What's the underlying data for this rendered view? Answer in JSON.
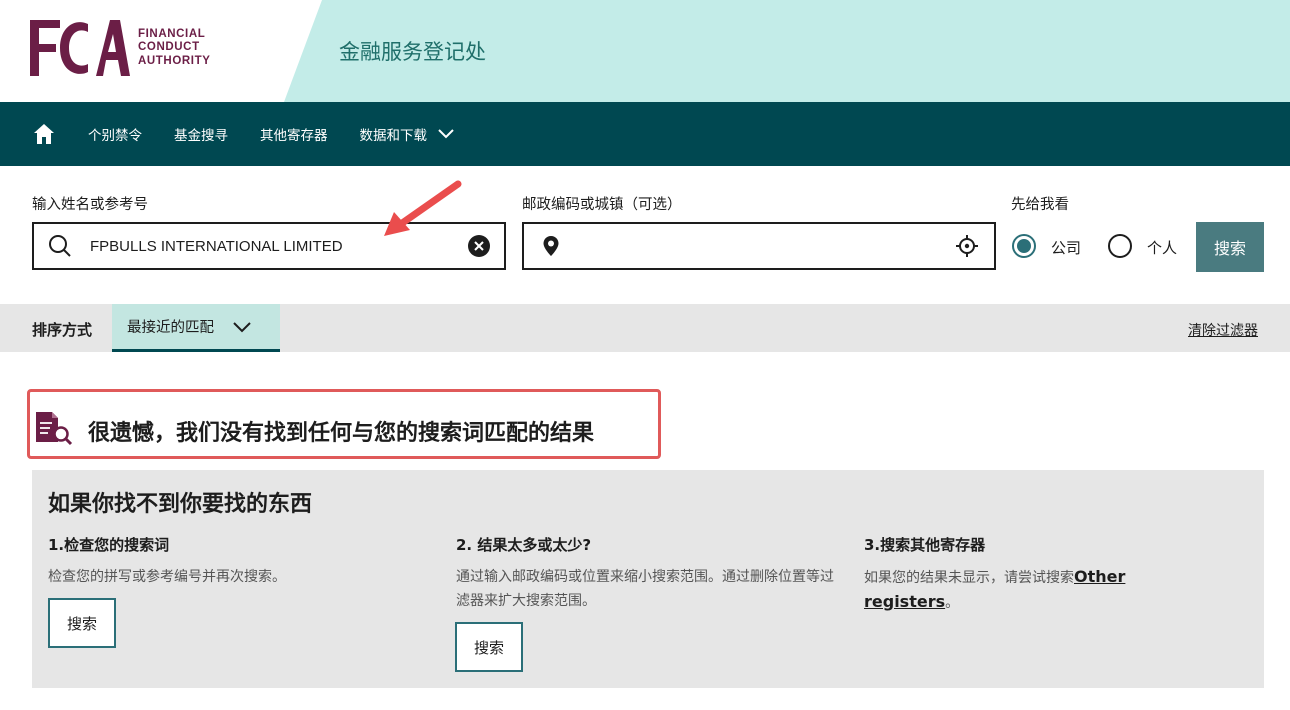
{
  "header": {
    "logo_letters": "FCA",
    "logo_lines": [
      "FINANCIAL",
      "CONDUCT",
      "AUTHORITY"
    ],
    "site_title": "金融服务登记处"
  },
  "nav": {
    "items": [
      {
        "label": "个别禁令"
      },
      {
        "label": "基金搜寻"
      },
      {
        "label": "其他寄存器"
      },
      {
        "label": "数据和下载"
      }
    ]
  },
  "search": {
    "name_label": "输入姓名或参考号",
    "name_value": "FPBULLS INTERNATIONAL LIMITED",
    "postcode_label": "邮政编码或城镇（可选）",
    "postcode_value": "",
    "view_label": "先给我看",
    "option_company": "公司",
    "option_person": "个人",
    "selected_option": "公司",
    "search_button": "搜索"
  },
  "sort": {
    "label": "排序方式",
    "selected": "最接近的匹配",
    "clear_filters": "清除过滤器"
  },
  "results": {
    "no_results_message": "很遗憾，我们没有找到任何与您的搜索词匹配的结果"
  },
  "help": {
    "title": "如果你找不到你要找的东西",
    "columns": [
      {
        "title": "1.检查您的搜索词",
        "text": "检查您的拼写或参考编号并再次搜索。",
        "button": "搜索"
      },
      {
        "title": "2. 结果太多或太少?",
        "text": "通过输入邮政编码或位置来缩小搜索范围。通过删除位置等过滤器来扩大搜索范围。",
        "button": "搜索"
      },
      {
        "title": "3.搜索其他寄存器",
        "text_before": "如果您的结果未显示，请尝试搜索",
        "link": "Other registers",
        "text_after": "。"
      }
    ]
  },
  "colors": {
    "nav_bg": "#004851",
    "header_band": "#c3ece8",
    "accent": "#2b6f78",
    "brand": "#6b1e46",
    "highlight_border": "#e05a5a",
    "annotation_arrow": "#ea4d4d"
  },
  "icons": {
    "home": "home-icon",
    "search": "search-icon",
    "clear": "clear-icon",
    "location": "location-pin-icon",
    "locate": "locate-crosshair-icon",
    "chevron": "chevron-down-icon",
    "no_results": "document-search-icon"
  }
}
